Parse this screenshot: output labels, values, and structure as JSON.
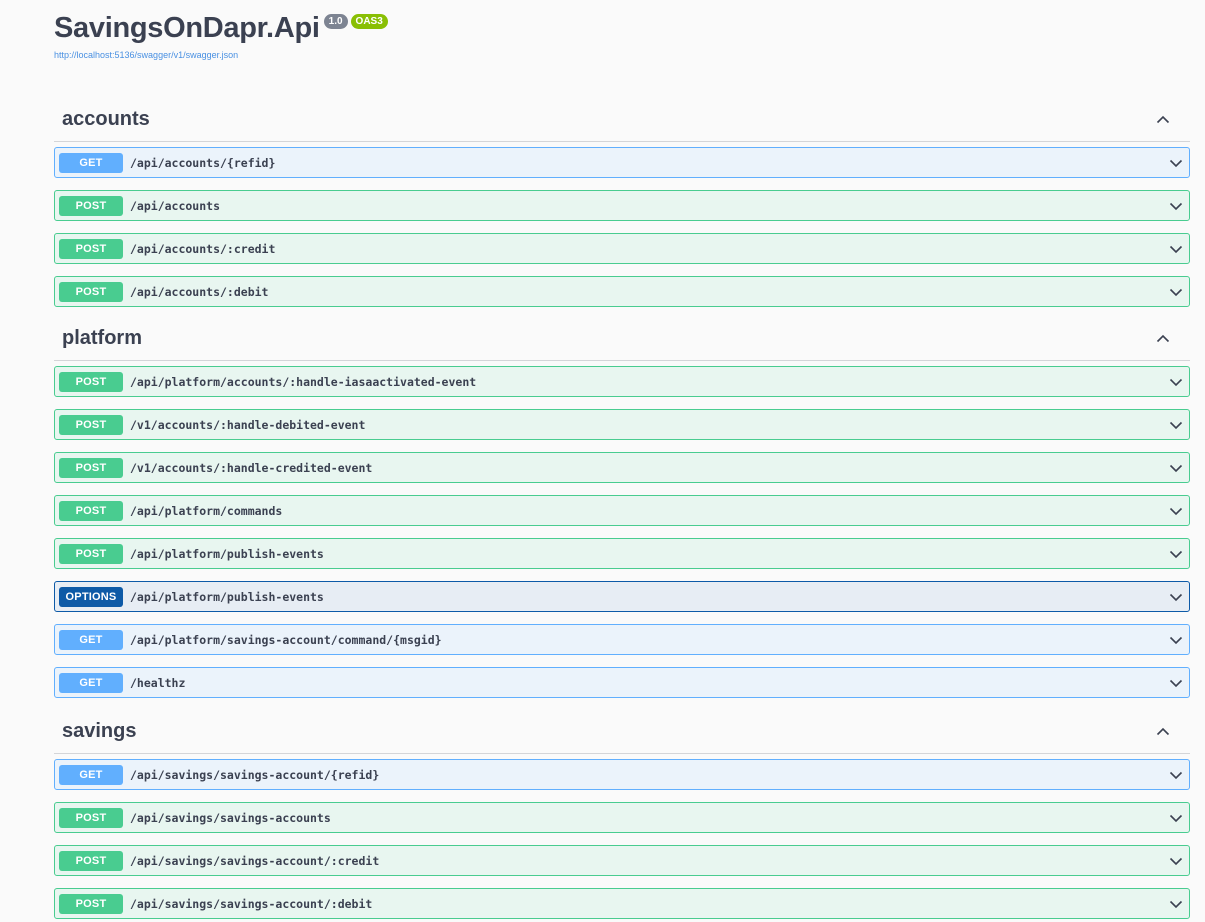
{
  "info": {
    "title": "SavingsOnDapr.Api",
    "version": "1.0",
    "oas": "OAS3",
    "spec_url": "http://localhost:5136/swagger/v1/swagger.json"
  },
  "tags": [
    {
      "name": "accounts",
      "operations": [
        {
          "method": "GET",
          "path": "/api/accounts/{refid}"
        },
        {
          "method": "POST",
          "path": "/api/accounts"
        },
        {
          "method": "POST",
          "path": "/api/accounts/:credit"
        },
        {
          "method": "POST",
          "path": "/api/accounts/:debit"
        }
      ]
    },
    {
      "name": "platform",
      "operations": [
        {
          "method": "POST",
          "path": "/api/platform/accounts/:handle-iasaactivated-event"
        },
        {
          "method": "POST",
          "path": "/v1/accounts/:handle-debited-event"
        },
        {
          "method": "POST",
          "path": "/v1/accounts/:handle-credited-event"
        },
        {
          "method": "POST",
          "path": "/api/platform/commands"
        },
        {
          "method": "POST",
          "path": "/api/platform/publish-events"
        },
        {
          "method": "OPTIONS",
          "path": "/api/platform/publish-events"
        },
        {
          "method": "GET",
          "path": "/api/platform/savings-account/command/{msgid}"
        },
        {
          "method": "GET",
          "path": "/healthz"
        }
      ]
    },
    {
      "name": "savings",
      "operations": [
        {
          "method": "GET",
          "path": "/api/savings/savings-account/{refid}"
        },
        {
          "method": "POST",
          "path": "/api/savings/savings-accounts"
        },
        {
          "method": "POST",
          "path": "/api/savings/savings-account/:credit"
        },
        {
          "method": "POST",
          "path": "/api/savings/savings-account/:debit"
        }
      ]
    }
  ],
  "icons": {
    "collapse": "chevron-up-icon",
    "expand": "chevron-down-icon"
  },
  "colors": {
    "get": "#61affe",
    "post": "#49cc90",
    "options": "#0d5aa7",
    "version_badge": "#7d8492",
    "oas_badge": "#89bf04",
    "link": "#4990e2"
  }
}
